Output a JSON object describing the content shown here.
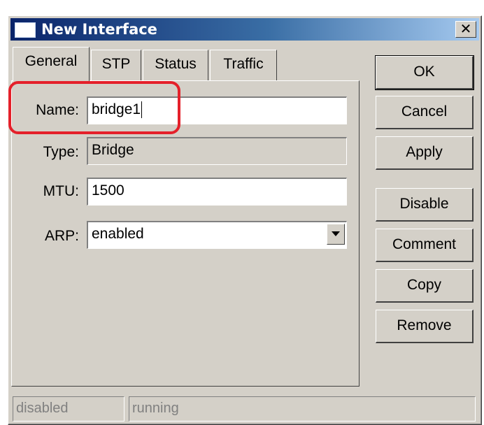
{
  "window": {
    "title": "New Interface",
    "close_glyph": "✕"
  },
  "tabs": [
    {
      "label": "General",
      "active": true
    },
    {
      "label": "STP",
      "active": false
    },
    {
      "label": "Status",
      "active": false
    },
    {
      "label": "Traffic",
      "active": false
    }
  ],
  "form": {
    "name": {
      "label": "Name:",
      "value": "bridge1"
    },
    "type": {
      "label": "Type:",
      "value": "Bridge"
    },
    "mtu": {
      "label": "MTU:",
      "value": "1500"
    },
    "arp": {
      "label": "ARP:",
      "value": "enabled"
    }
  },
  "buttons": {
    "ok": "OK",
    "cancel": "Cancel",
    "apply": "Apply",
    "disable": "Disable",
    "comment": "Comment",
    "copy": "Copy",
    "remove": "Remove"
  },
  "statusbar": {
    "left": "disabled",
    "right": "running"
  },
  "colors": {
    "window_bg": "#d4d0c8",
    "title_start": "#0a246a",
    "title_end": "#a6caf0",
    "highlight": "#e4202a"
  }
}
